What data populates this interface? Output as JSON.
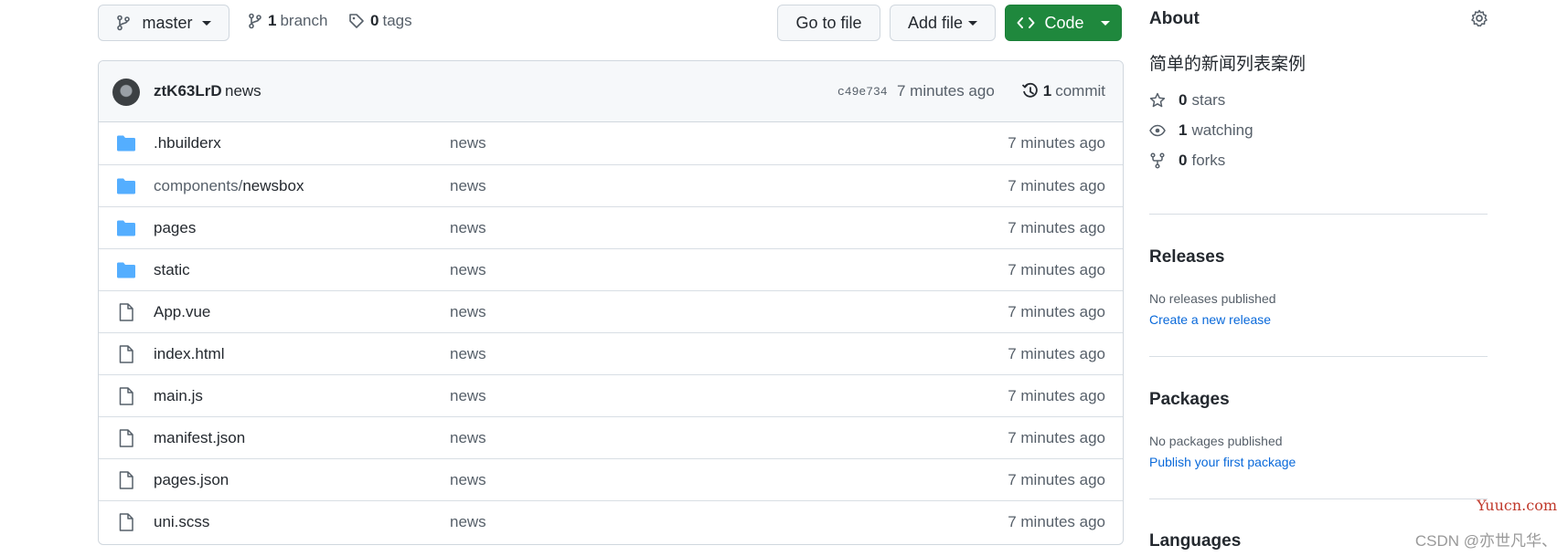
{
  "toolbar": {
    "branch_button": "master",
    "branches_count": "1",
    "branches_label": "branch",
    "tags_count": "0",
    "tags_label": "tags",
    "go_to_file": "Go to file",
    "add_file": "Add file",
    "code": "Code"
  },
  "commit": {
    "author": "ztK63LrD",
    "message": "news",
    "hash": "c49e734",
    "time": "7 minutes ago",
    "commits_count": "1",
    "commits_label": "commit"
  },
  "files": [
    {
      "type": "folder",
      "name": ".hbuilderx",
      "message": "news",
      "age": "7 minutes ago"
    },
    {
      "type": "folder",
      "prefix": "components/",
      "name": "newsbox",
      "message": "news",
      "age": "7 minutes ago"
    },
    {
      "type": "folder",
      "name": "pages",
      "message": "news",
      "age": "7 minutes ago"
    },
    {
      "type": "folder",
      "name": "static",
      "message": "news",
      "age": "7 minutes ago"
    },
    {
      "type": "file",
      "name": "App.vue",
      "message": "news",
      "age": "7 minutes ago"
    },
    {
      "type": "file",
      "name": "index.html",
      "message": "news",
      "age": "7 minutes ago"
    },
    {
      "type": "file",
      "name": "main.js",
      "message": "news",
      "age": "7 minutes ago"
    },
    {
      "type": "file",
      "name": "manifest.json",
      "message": "news",
      "age": "7 minutes ago"
    },
    {
      "type": "file",
      "name": "pages.json",
      "message": "news",
      "age": "7 minutes ago"
    },
    {
      "type": "file",
      "name": "uni.scss",
      "message": "news",
      "age": "7 minutes ago"
    }
  ],
  "about": {
    "title": "About",
    "description": "简单的新闻列表案例",
    "stars_count": "0",
    "stars_label": "stars",
    "watching_count": "1",
    "watching_label": "watching",
    "forks_count": "0",
    "forks_label": "forks"
  },
  "releases": {
    "title": "Releases",
    "empty": "No releases published",
    "link": "Create a new release"
  },
  "packages": {
    "title": "Packages",
    "empty": "No packages published",
    "link": "Publish your first package"
  },
  "languages": {
    "title": "Languages"
  },
  "watermarks": {
    "site": "Yuucn.com",
    "author": "CSDN @亦世凡华、"
  },
  "colors": {
    "accent_green": "#1f883d",
    "link_blue": "#0969da",
    "folder_blue": "#54aeff"
  }
}
